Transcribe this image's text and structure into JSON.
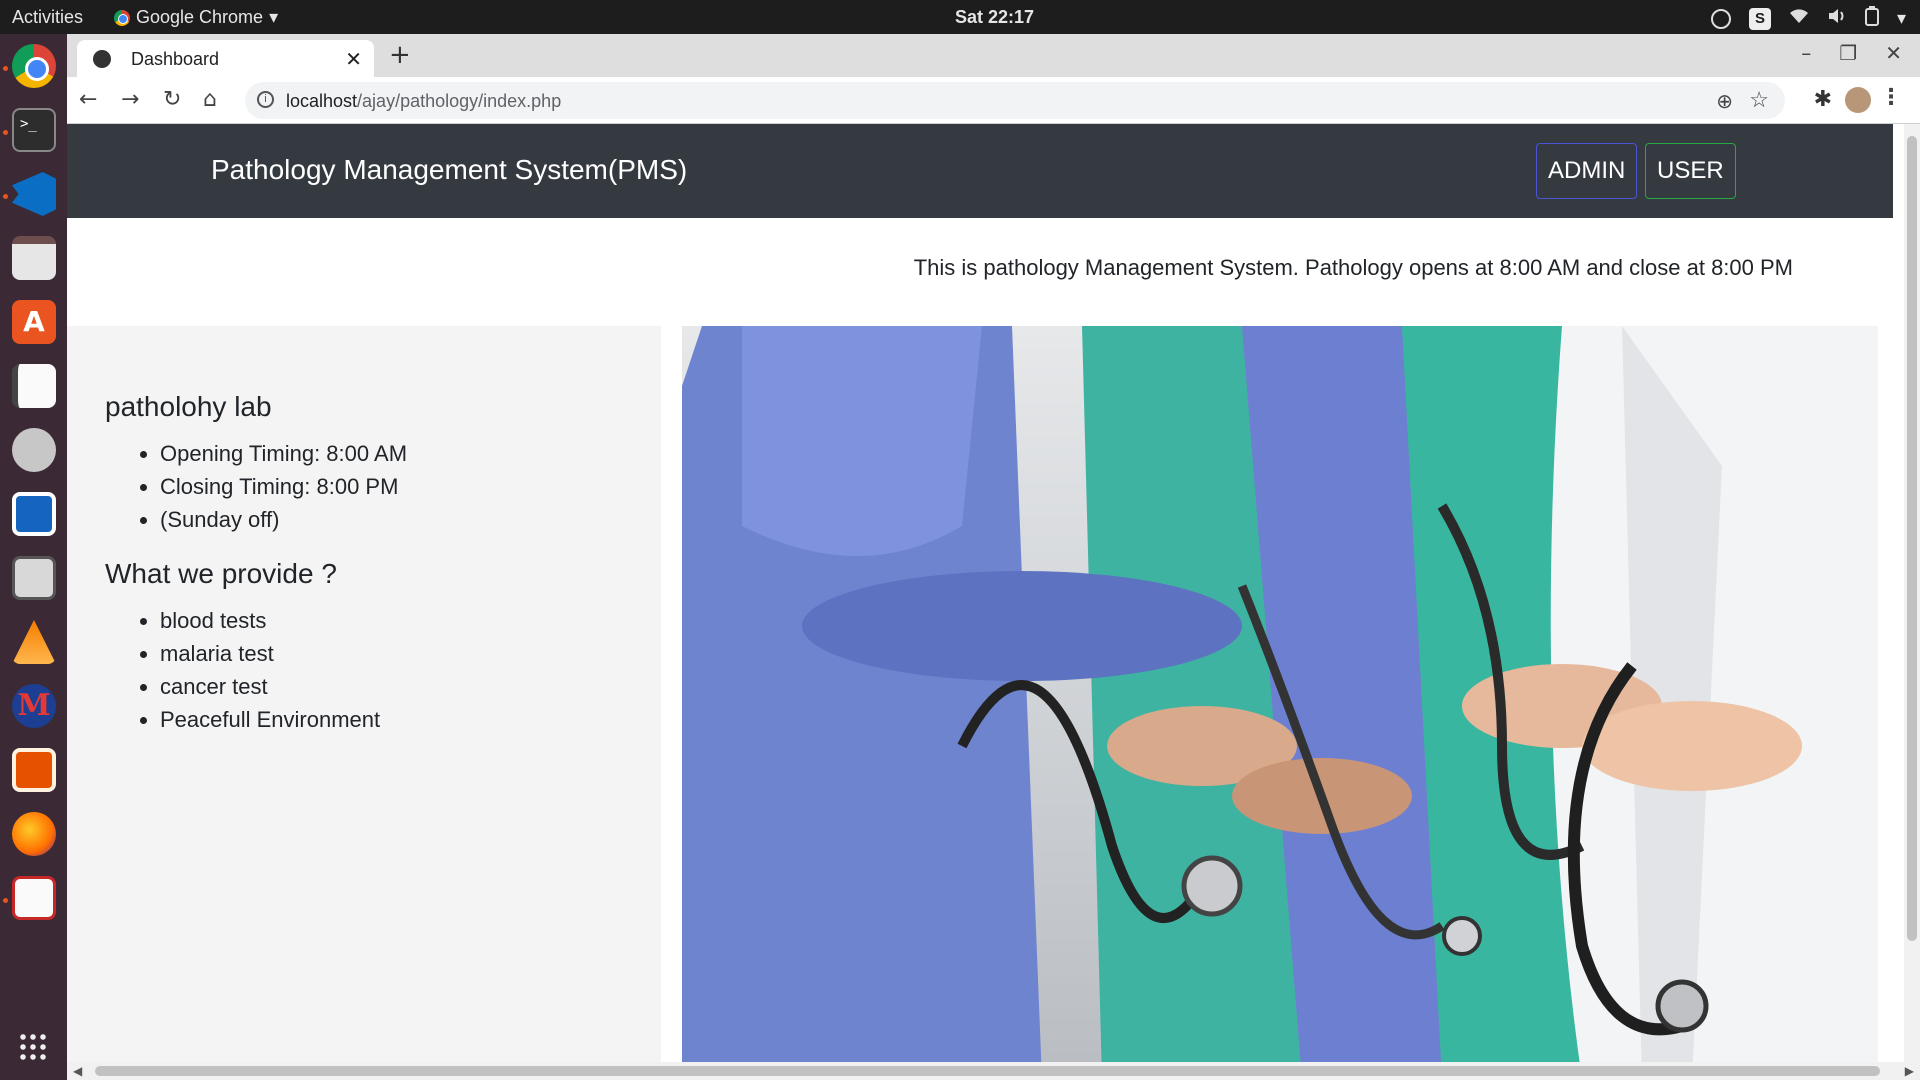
{
  "system": {
    "activities": "Activities",
    "app_name": "Google Chrome",
    "clock": "Sat 22:17"
  },
  "dock": {
    "items": [
      "chrome-icon",
      "terminal-icon",
      "vscode-icon",
      "files-icon",
      "software-store-icon",
      "text-editor-icon",
      "tools-icon",
      "writer-icon",
      "calculator-icon",
      "vlc-icon",
      "m-app-icon",
      "impress-icon",
      "firefox-icon",
      "document-viewer-icon"
    ],
    "show_apps_icon": "apps-grid-icon",
    "accent": "#e95420"
  },
  "browser": {
    "tab_title": "Dashboard",
    "url_host": "localhost",
    "url_path": "/ajay/pathology/index.php"
  },
  "page": {
    "brand": "Pathology Management System(PMS)",
    "admin_label": "ADMIN",
    "user_label": "USER",
    "announcement": "This is pathology Management System. Pathology opens at 8:00 AM and close at 8:00 PM",
    "lab": {
      "heading": "patholohy lab",
      "items": [
        "Opening Timing: 8:00 AM",
        "Closing Timing: 8:00 PM",
        "(Sunday off)"
      ]
    },
    "provide": {
      "heading": "What we provide ?",
      "items": [
        "blood tests",
        "malaria test",
        "cancer test",
        "Peacefull Environment"
      ]
    },
    "colors": {
      "navbar_bg": "#343a40",
      "admin_border": "#4a54d4",
      "user_border": "#28a745",
      "sidebar_bg": "#f4f4f4"
    }
  }
}
